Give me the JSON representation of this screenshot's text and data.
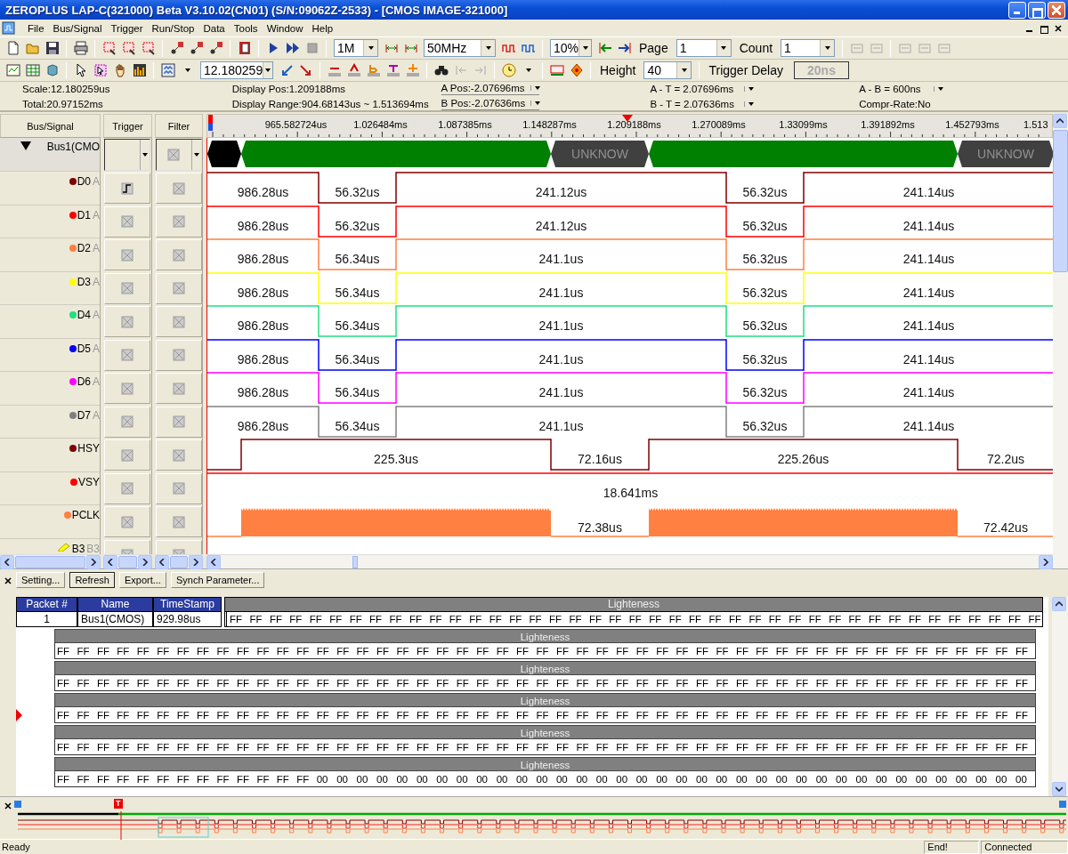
{
  "window": {
    "title": "ZEROPLUS LAP-C(321000) Beta V3.10.02(CN01) (S/N:09062Z-2533) - [CMOS IMAGE-321000]"
  },
  "menu": [
    "File",
    "Bus/Signal",
    "Trigger",
    "Run/Stop",
    "Data",
    "Tools",
    "Window",
    "Help"
  ],
  "toolbar1": [
    {
      "kind": "combo",
      "value": "1M"
    },
    {
      "kind": "combo",
      "value": "50MHz"
    },
    {
      "kind": "combo",
      "value": "10%"
    },
    {
      "kind": "label",
      "text": "Page"
    },
    {
      "kind": "combo",
      "value": "1"
    },
    {
      "kind": "label",
      "text": "Count"
    },
    {
      "kind": "combo",
      "value": "1"
    }
  ],
  "toolbar2": [
    {
      "kind": "combo",
      "value": "12.180259"
    },
    {
      "kind": "label",
      "text": "Height"
    },
    {
      "kind": "combo",
      "value": "40"
    },
    {
      "kind": "label",
      "text": "Trigger Delay"
    },
    {
      "kind": "field",
      "value": "20ns",
      "disabled": true
    }
  ],
  "info_columns": [
    [
      {
        "text": "Scale:12.180259us",
        "dropdown": false
      },
      {
        "text": "Total:20.97152ms",
        "dropdown": false
      }
    ],
    [
      {
        "text": "Display Pos:1.209188ms",
        "dropdown": false
      },
      {
        "text": "Display Range:904.68143us ~ 1.513694ms",
        "dropdown": false
      }
    ],
    [
      {
        "text": "A Pos:-2.07696ms",
        "dropdown": true
      },
      {
        "text": "B Pos:-2.07636ms",
        "dropdown": true
      }
    ],
    [
      {
        "text": "A - T = 2.07696ms",
        "dropdown": true
      },
      {
        "text": "B - T = 2.07636ms",
        "dropdown": true
      }
    ],
    [
      {
        "text": "A - B = 600ns",
        "dropdown": true
      },
      {
        "text": "Compr-Rate:No",
        "dropdown": false
      }
    ]
  ],
  "columns": [
    "Bus/Signal",
    "Trigger",
    "Filter"
  ],
  "ruler": [
    "965.582724us",
    "1.026484ms",
    "1.087385ms",
    "1.148287ms",
    "1.209188ms",
    "1.270089ms",
    "1.33099ms",
    "1.391892ms",
    "1.452793ms",
    "1.513"
  ],
  "signals": [
    {
      "kind": "bus",
      "name": "Bus1(CMO",
      "expanded": true,
      "wave": {
        "kind": "bus",
        "segments": [
          {
            "kind": "blank"
          },
          {
            "kind": "data"
          },
          {
            "kind": "unknown",
            "label": "UNKNOW"
          },
          {
            "kind": "data"
          },
          {
            "kind": "unknown",
            "label": "UNKNOW"
          }
        ]
      }
    },
    {
      "kind": "signal",
      "name": "D0",
      "channel": "A",
      "color": "#800000",
      "edge_trigger": true,
      "wave": {
        "kind": "data",
        "segments": [
          {
            "high": true,
            "label": "986.28us"
          },
          {
            "high": false,
            "label": "56.32us"
          },
          {
            "high": true,
            "label": "241.12us"
          },
          {
            "high": false,
            "label": "56.32us"
          },
          {
            "high": true,
            "label": "241.14us"
          }
        ]
      }
    },
    {
      "kind": "signal",
      "name": "D1",
      "channel": "A",
      "color": "#ff0000",
      "edge_trigger": false,
      "wave": {
        "kind": "data",
        "segments": [
          {
            "high": true,
            "label": "986.28us"
          },
          {
            "high": false,
            "label": "56.32us"
          },
          {
            "high": true,
            "label": "241.12us"
          },
          {
            "high": false,
            "label": "56.32us"
          },
          {
            "high": true,
            "label": "241.14us"
          }
        ]
      }
    },
    {
      "kind": "signal",
      "name": "D2",
      "channel": "A",
      "color": "#ff8040",
      "edge_trigger": false,
      "wave": {
        "kind": "data",
        "segments": [
          {
            "high": true,
            "label": "986.28us"
          },
          {
            "high": false,
            "label": "56.34us"
          },
          {
            "high": true,
            "label": "241.1us"
          },
          {
            "high": false,
            "label": "56.32us"
          },
          {
            "high": true,
            "label": "241.14us"
          }
        ]
      }
    },
    {
      "kind": "signal",
      "name": "D3",
      "channel": "A",
      "color": "#ffff00",
      "edge_trigger": false,
      "wave": {
        "kind": "data",
        "segments": [
          {
            "high": true,
            "label": "986.28us"
          },
          {
            "high": false,
            "label": "56.34us"
          },
          {
            "high": true,
            "label": "241.1us"
          },
          {
            "high": false,
            "label": "56.32us"
          },
          {
            "high": true,
            "label": "241.14us"
          }
        ]
      }
    },
    {
      "kind": "signal",
      "name": "D4",
      "channel": "A",
      "color": "#20e080",
      "edge_trigger": false,
      "wave": {
        "kind": "data",
        "segments": [
          {
            "high": true,
            "label": "986.28us"
          },
          {
            "high": false,
            "label": "56.34us"
          },
          {
            "high": true,
            "label": "241.1us"
          },
          {
            "high": false,
            "label": "56.32us"
          },
          {
            "high": true,
            "label": "241.14us"
          }
        ]
      }
    },
    {
      "kind": "signal",
      "name": "D5",
      "channel": "A",
      "color": "#0000ff",
      "edge_trigger": false,
      "wave": {
        "kind": "data",
        "segments": [
          {
            "high": true,
            "label": "986.28us"
          },
          {
            "high": false,
            "label": "56.34us"
          },
          {
            "high": true,
            "label": "241.1us"
          },
          {
            "high": false,
            "label": "56.32us"
          },
          {
            "high": true,
            "label": "241.14us"
          }
        ]
      }
    },
    {
      "kind": "signal",
      "name": "D6",
      "channel": "A",
      "color": "#ff00ff",
      "edge_trigger": false,
      "wave": {
        "kind": "data",
        "segments": [
          {
            "high": true,
            "label": "986.28us"
          },
          {
            "high": false,
            "label": "56.34us"
          },
          {
            "high": true,
            "label": "241.1us"
          },
          {
            "high": false,
            "label": "56.32us"
          },
          {
            "high": true,
            "label": "241.14us"
          }
        ]
      }
    },
    {
      "kind": "signal",
      "name": "D7",
      "channel": "A",
      "color": "#808080",
      "edge_trigger": false,
      "wave": {
        "kind": "data",
        "segments": [
          {
            "high": true,
            "label": "986.28us"
          },
          {
            "high": false,
            "label": "56.34us"
          },
          {
            "high": true,
            "label": "241.1us"
          },
          {
            "high": false,
            "label": "56.32us"
          },
          {
            "high": true,
            "label": "241.14us"
          }
        ]
      }
    },
    {
      "kind": "signal",
      "name": "HSY",
      "color": "#800000",
      "edge_trigger": false,
      "wave": {
        "kind": "sync",
        "segments": [
          {
            "high": false
          },
          {
            "high": true,
            "label": "225.3us"
          },
          {
            "high": false,
            "label": "72.16us"
          },
          {
            "high": true,
            "label": "225.26us"
          },
          {
            "high": false,
            "label": "72.2us"
          }
        ]
      }
    },
    {
      "kind": "signal",
      "name": "VSY",
      "color": "#ff0000",
      "edge_trigger": false,
      "wave": {
        "kind": "level",
        "segments": [
          {
            "high": true,
            "label": "18.641ms"
          }
        ]
      }
    },
    {
      "kind": "signal",
      "name": "PCLK",
      "color": "#ff8040",
      "edge_trigger": false,
      "wave": {
        "kind": "clock",
        "segments": [
          {
            "high": false
          },
          {
            "high": true
          },
          {
            "high": false,
            "label": "72.38us"
          },
          {
            "high": true
          },
          {
            "high": false,
            "label": "72.42us"
          }
        ]
      }
    },
    {
      "kind": "group",
      "name": "B3",
      "channel": "B3",
      "color": "#ffff00",
      "edge_trigger": false
    }
  ],
  "packet_panel": {
    "buttons": [
      "Setting...",
      "Refresh",
      "Export...",
      "Synch Parameter..."
    ],
    "columns": [
      "Packet #",
      "Name",
      "TimeStamp",
      "Lighteness"
    ],
    "row": {
      "packet": "1",
      "name": "Bus1(CMOS)",
      "timestamp": "929.98us",
      "data": "FF FF FF FF FF FF FF FF FF FF FF FF FF FF FF FF FF FF FF FF FF FF FF FF FF FF FF FF FF FF FF FF FF FF FF FF FF FF FF FF FF"
    },
    "blocks": [
      {
        "header": "Lighteness",
        "current": false,
        "data": "FF FF FF FF FF FF FF FF FF FF FF FF FF FF FF FF FF FF FF FF FF FF FF FF FF FF FF FF FF FF FF FF FF FF FF FF FF FF FF FF FF FF FF FF FF FF FF FF FF"
      },
      {
        "header": "Lighteness",
        "current": false,
        "data": "FF FF FF FF FF FF FF FF FF FF FF FF FF FF FF FF FF FF FF FF FF FF FF FF FF FF FF FF FF FF FF FF FF FF FF FF FF FF FF FF FF FF FF FF FF FF FF FF FF"
      },
      {
        "header": "Lighteness",
        "current": true,
        "data": "FF FF FF FF FF FF FF FF FF FF FF FF FF FF FF FF FF FF FF FF FF FF FF FF FF FF FF FF FF FF FF FF FF FF FF FF FF FF FF FF FF FF FF FF FF FF FF FF FF"
      },
      {
        "header": "Lighteness",
        "current": false,
        "data": "FF FF FF FF FF FF FF FF FF FF FF FF FF FF FF FF FF FF FF FF FF FF FF FF FF FF FF FF FF FF FF FF FF FF FF FF FF FF FF FF FF FF FF FF FF FF FF FF FF"
      },
      {
        "header": "Lighteness",
        "current": false,
        "data": "FF FF FF FF FF FF FF FF FF FF FF FF FF 00 00 00 00 00 00 00 00 00 00 00 00 00 00 00 00 00 00 00 00 00 00 00 00 00 00 00 00 00 00 00 00 00 00 00 00"
      }
    ]
  },
  "overview": {
    "trigger_marker": "T"
  },
  "status_bar": {
    "message": "Ready",
    "panels": [
      "End!",
      "Connected"
    ]
  }
}
